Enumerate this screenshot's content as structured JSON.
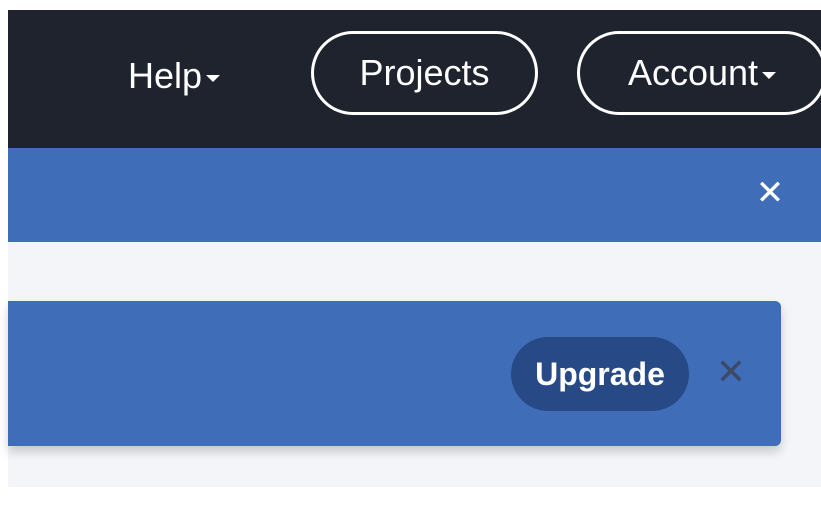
{
  "nav": {
    "help_label": "Help",
    "projects_label": "Projects",
    "account_label": "Account"
  },
  "announcement": {
    "close_glyph": "✕"
  },
  "card": {
    "upgrade_label": "Upgrade",
    "close_glyph": "✕"
  },
  "colors": {
    "nav_bg": "#1f232e",
    "accent_blue": "#3f6db7",
    "button_dark_blue": "#274a86",
    "content_bg": "#f3f5f9"
  },
  "icons": {
    "help_dropdown": "caret-down-icon",
    "account_dropdown": "caret-down-icon",
    "announcement_close": "close-icon",
    "card_close": "close-icon"
  }
}
